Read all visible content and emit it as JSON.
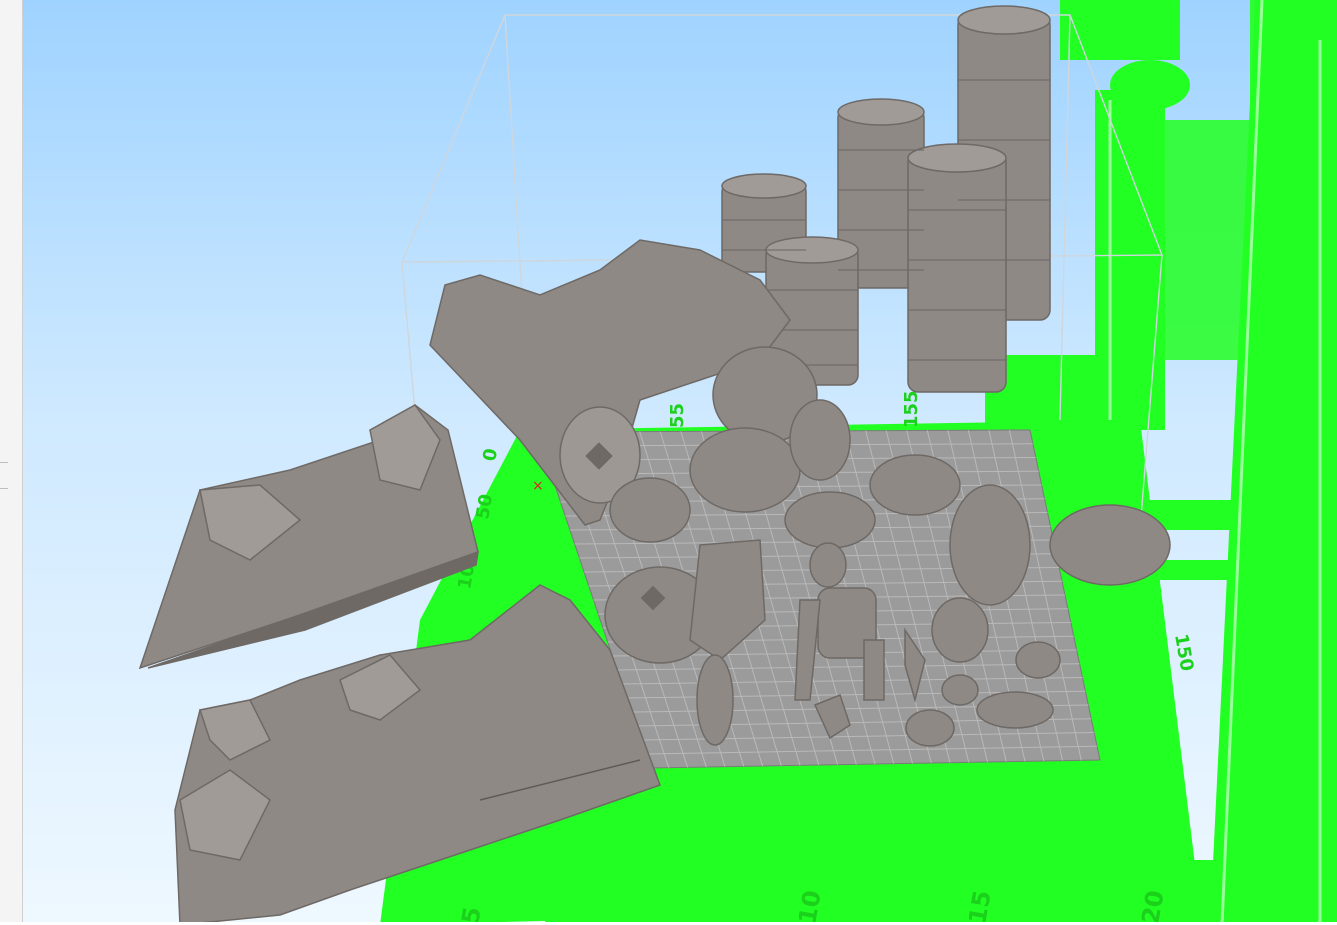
{
  "app": {
    "view": "3d-build-plate-preview"
  },
  "colors": {
    "sky_top": "#9fd3ff",
    "sky_bottom": "#eef8ff",
    "printer_frame": "#22ff22",
    "build_plate": "#9b9b9b",
    "model": "#8f8986",
    "origin_marker": "#e02020",
    "build_volume_edges": "#d0d0d0"
  },
  "axis_labels": {
    "x_top": [
      "55",
      "155"
    ],
    "y_left": [
      "0",
      "50",
      "100"
    ],
    "x_bottom": [
      "5",
      "10",
      "15",
      "20"
    ],
    "y_right": [
      "150"
    ]
  },
  "objects": {
    "towers": [
      "tower-1",
      "tower-2",
      "tower-3",
      "tower-4",
      "tower-5"
    ],
    "terrain": [
      "terrain-left",
      "terrain-front"
    ],
    "figures": [
      "giant-arm",
      "giant-torso",
      "giant-hand",
      "minifigure",
      "helmet",
      "shield",
      "weapon-blade",
      "pottery",
      "base-rock"
    ]
  }
}
